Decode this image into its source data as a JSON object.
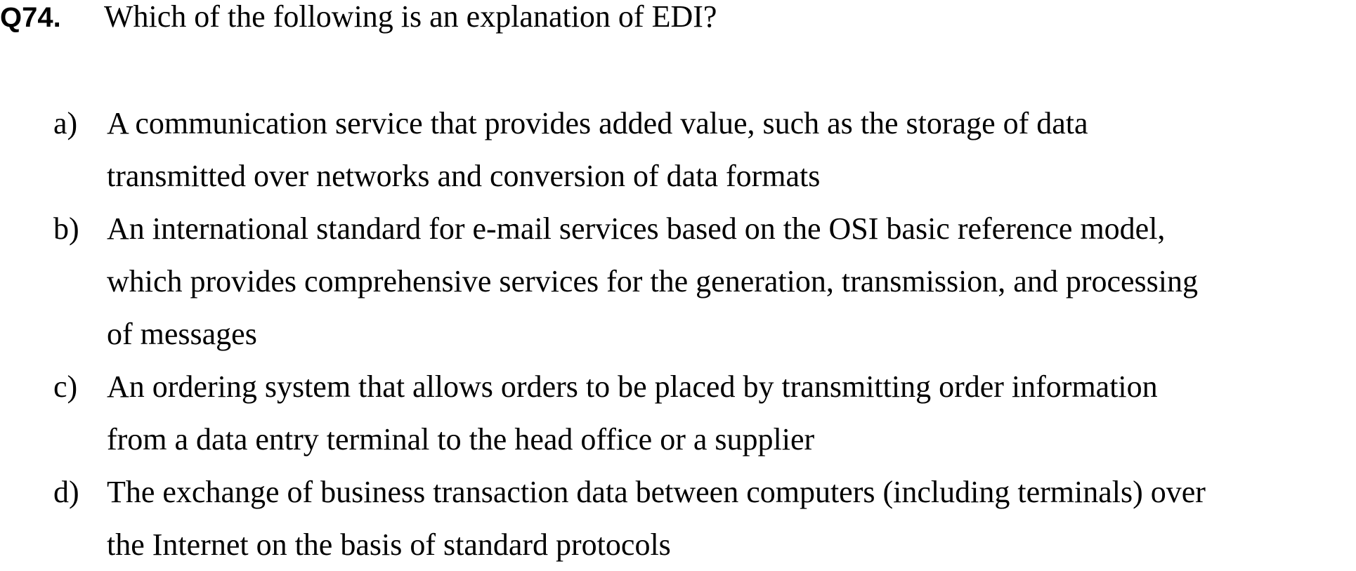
{
  "question": {
    "number": "Q74.",
    "text": "Which of the following is an explanation of EDI?"
  },
  "options": [
    {
      "letter": "a)",
      "lines": [
        "A communication service that provides added value, such as the storage of data",
        "transmitted over networks and conversion of data formats"
      ]
    },
    {
      "letter": "b)",
      "lines": [
        "An international standard for e-mail services based on the OSI basic reference model,",
        "which provides comprehensive services for the generation, transmission, and processing",
        "of messages"
      ]
    },
    {
      "letter": "c)",
      "lines": [
        "An ordering system that allows orders to be placed by transmitting order information",
        "from a data entry terminal to the head office or a supplier"
      ]
    },
    {
      "letter": "d)",
      "lines": [
        "The exchange of business transaction data between computers (including terminals) over",
        "the Internet on the basis of standard protocols"
      ]
    }
  ]
}
